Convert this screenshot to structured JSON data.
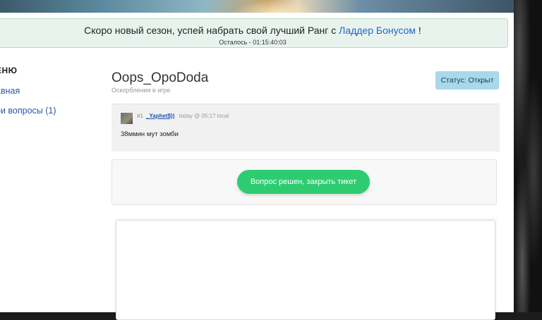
{
  "announcement": {
    "text_before": "Скоро новый сезон, успей набрать свой лучший Ранг с ",
    "link": "Ладдер Бонусом",
    "text_after": " !",
    "countdown": "Осталось - 01:15:40:03"
  },
  "menu": {
    "title": "ЕНЮ",
    "items": [
      {
        "label": "авная"
      },
      {
        "label": "ои вопросы (1)"
      }
    ]
  },
  "ticket": {
    "title": "Oops_OpoDoda",
    "category": "Оскорбления в игре",
    "status": "Статус: Открыт"
  },
  "post": {
    "number": "#1",
    "author": "_Yaphet$))",
    "time": "today @ 05:17 local",
    "text": "38ммин мут зомби"
  },
  "actions": {
    "close_label": "Вопрос решен, закрыть тикет"
  },
  "colors": {
    "accent_green": "#2ecc71",
    "status_blue": "#a8d8ea",
    "link_blue": "#2366c7"
  }
}
